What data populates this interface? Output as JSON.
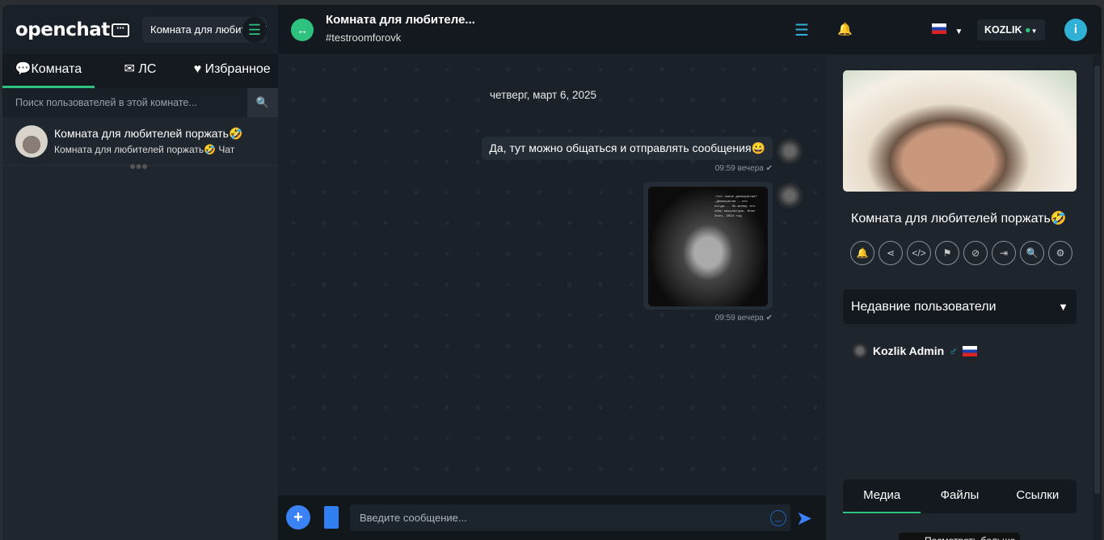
{
  "sidebar": {
    "logo": "openchat",
    "room_select": "Комната для любителей поржать",
    "tabs": [
      {
        "label": "Комната"
      },
      {
        "label": "ЛС"
      },
      {
        "label": "Избранное"
      }
    ],
    "search_placeholder": "Поиск пользователей в этой комнате...",
    "rooms": [
      {
        "title": "Комната для любителей поржать🤣",
        "subtitle": "Комната для любителей поржать🤣 Чат"
      }
    ]
  },
  "header": {
    "title": "Комната для любителе...",
    "subtitle": "#testroomforovk",
    "user": "KOZLIK",
    "status_color": "#2ec27e"
  },
  "chat": {
    "date": "четверг, март 6, 2025",
    "messages": [
      {
        "text": "Да, тут можно общаться и отправлять сообщения😀",
        "time": "09:59 вечера"
      },
      {
        "image_caption": "-Что такое демократия? -Демократия - это когда... По-моему это сбор макулатуры. Илон Эсон, 2024 год",
        "time": "09:59 вечера"
      }
    ],
    "input_placeholder": "Введите сообщение..."
  },
  "panel": {
    "room_name": "Комната для любителей поржать🤣",
    "recent_title": "Недавние пользователи",
    "users": [
      {
        "name": "Kozlik Admin",
        "gender": "♂"
      }
    ],
    "media_tabs": [
      {
        "label": "Медиа"
      },
      {
        "label": "Файлы"
      },
      {
        "label": "Ссылки"
      }
    ],
    "more": "Посмотреть больше"
  },
  "colors": {
    "accent": "#2ec27e",
    "blue": "#3b82f6",
    "info": "#31b0d5"
  }
}
